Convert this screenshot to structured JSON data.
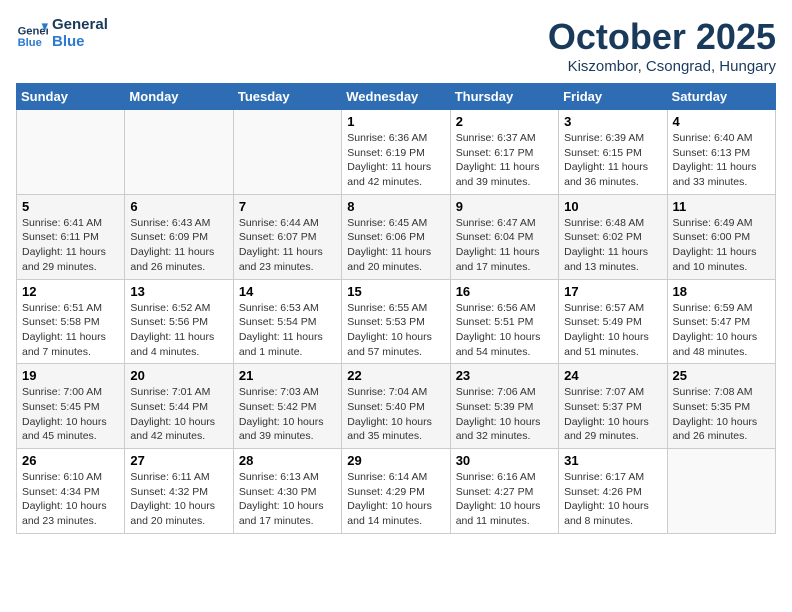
{
  "header": {
    "logo_line1": "General",
    "logo_line2": "Blue",
    "month": "October 2025",
    "location": "Kiszombor, Csongrad, Hungary"
  },
  "weekdays": [
    "Sunday",
    "Monday",
    "Tuesday",
    "Wednesday",
    "Thursday",
    "Friday",
    "Saturday"
  ],
  "weeks": [
    [
      {
        "day": "",
        "info": ""
      },
      {
        "day": "",
        "info": ""
      },
      {
        "day": "",
        "info": ""
      },
      {
        "day": "1",
        "info": "Sunrise: 6:36 AM\nSunset: 6:19 PM\nDaylight: 11 hours\nand 42 minutes."
      },
      {
        "day": "2",
        "info": "Sunrise: 6:37 AM\nSunset: 6:17 PM\nDaylight: 11 hours\nand 39 minutes."
      },
      {
        "day": "3",
        "info": "Sunrise: 6:39 AM\nSunset: 6:15 PM\nDaylight: 11 hours\nand 36 minutes."
      },
      {
        "day": "4",
        "info": "Sunrise: 6:40 AM\nSunset: 6:13 PM\nDaylight: 11 hours\nand 33 minutes."
      }
    ],
    [
      {
        "day": "5",
        "info": "Sunrise: 6:41 AM\nSunset: 6:11 PM\nDaylight: 11 hours\nand 29 minutes."
      },
      {
        "day": "6",
        "info": "Sunrise: 6:43 AM\nSunset: 6:09 PM\nDaylight: 11 hours\nand 26 minutes."
      },
      {
        "day": "7",
        "info": "Sunrise: 6:44 AM\nSunset: 6:07 PM\nDaylight: 11 hours\nand 23 minutes."
      },
      {
        "day": "8",
        "info": "Sunrise: 6:45 AM\nSunset: 6:06 PM\nDaylight: 11 hours\nand 20 minutes."
      },
      {
        "day": "9",
        "info": "Sunrise: 6:47 AM\nSunset: 6:04 PM\nDaylight: 11 hours\nand 17 minutes."
      },
      {
        "day": "10",
        "info": "Sunrise: 6:48 AM\nSunset: 6:02 PM\nDaylight: 11 hours\nand 13 minutes."
      },
      {
        "day": "11",
        "info": "Sunrise: 6:49 AM\nSunset: 6:00 PM\nDaylight: 11 hours\nand 10 minutes."
      }
    ],
    [
      {
        "day": "12",
        "info": "Sunrise: 6:51 AM\nSunset: 5:58 PM\nDaylight: 11 hours\nand 7 minutes."
      },
      {
        "day": "13",
        "info": "Sunrise: 6:52 AM\nSunset: 5:56 PM\nDaylight: 11 hours\nand 4 minutes."
      },
      {
        "day": "14",
        "info": "Sunrise: 6:53 AM\nSunset: 5:54 PM\nDaylight: 11 hours\nand 1 minute."
      },
      {
        "day": "15",
        "info": "Sunrise: 6:55 AM\nSunset: 5:53 PM\nDaylight: 10 hours\nand 57 minutes."
      },
      {
        "day": "16",
        "info": "Sunrise: 6:56 AM\nSunset: 5:51 PM\nDaylight: 10 hours\nand 54 minutes."
      },
      {
        "day": "17",
        "info": "Sunrise: 6:57 AM\nSunset: 5:49 PM\nDaylight: 10 hours\nand 51 minutes."
      },
      {
        "day": "18",
        "info": "Sunrise: 6:59 AM\nSunset: 5:47 PM\nDaylight: 10 hours\nand 48 minutes."
      }
    ],
    [
      {
        "day": "19",
        "info": "Sunrise: 7:00 AM\nSunset: 5:45 PM\nDaylight: 10 hours\nand 45 minutes."
      },
      {
        "day": "20",
        "info": "Sunrise: 7:01 AM\nSunset: 5:44 PM\nDaylight: 10 hours\nand 42 minutes."
      },
      {
        "day": "21",
        "info": "Sunrise: 7:03 AM\nSunset: 5:42 PM\nDaylight: 10 hours\nand 39 minutes."
      },
      {
        "day": "22",
        "info": "Sunrise: 7:04 AM\nSunset: 5:40 PM\nDaylight: 10 hours\nand 35 minutes."
      },
      {
        "day": "23",
        "info": "Sunrise: 7:06 AM\nSunset: 5:39 PM\nDaylight: 10 hours\nand 32 minutes."
      },
      {
        "day": "24",
        "info": "Sunrise: 7:07 AM\nSunset: 5:37 PM\nDaylight: 10 hours\nand 29 minutes."
      },
      {
        "day": "25",
        "info": "Sunrise: 7:08 AM\nSunset: 5:35 PM\nDaylight: 10 hours\nand 26 minutes."
      }
    ],
    [
      {
        "day": "26",
        "info": "Sunrise: 6:10 AM\nSunset: 4:34 PM\nDaylight: 10 hours\nand 23 minutes."
      },
      {
        "day": "27",
        "info": "Sunrise: 6:11 AM\nSunset: 4:32 PM\nDaylight: 10 hours\nand 20 minutes."
      },
      {
        "day": "28",
        "info": "Sunrise: 6:13 AM\nSunset: 4:30 PM\nDaylight: 10 hours\nand 17 minutes."
      },
      {
        "day": "29",
        "info": "Sunrise: 6:14 AM\nSunset: 4:29 PM\nDaylight: 10 hours\nand 14 minutes."
      },
      {
        "day": "30",
        "info": "Sunrise: 6:16 AM\nSunset: 4:27 PM\nDaylight: 10 hours\nand 11 minutes."
      },
      {
        "day": "31",
        "info": "Sunrise: 6:17 AM\nSunset: 4:26 PM\nDaylight: 10 hours\nand 8 minutes."
      },
      {
        "day": "",
        "info": ""
      }
    ]
  ]
}
